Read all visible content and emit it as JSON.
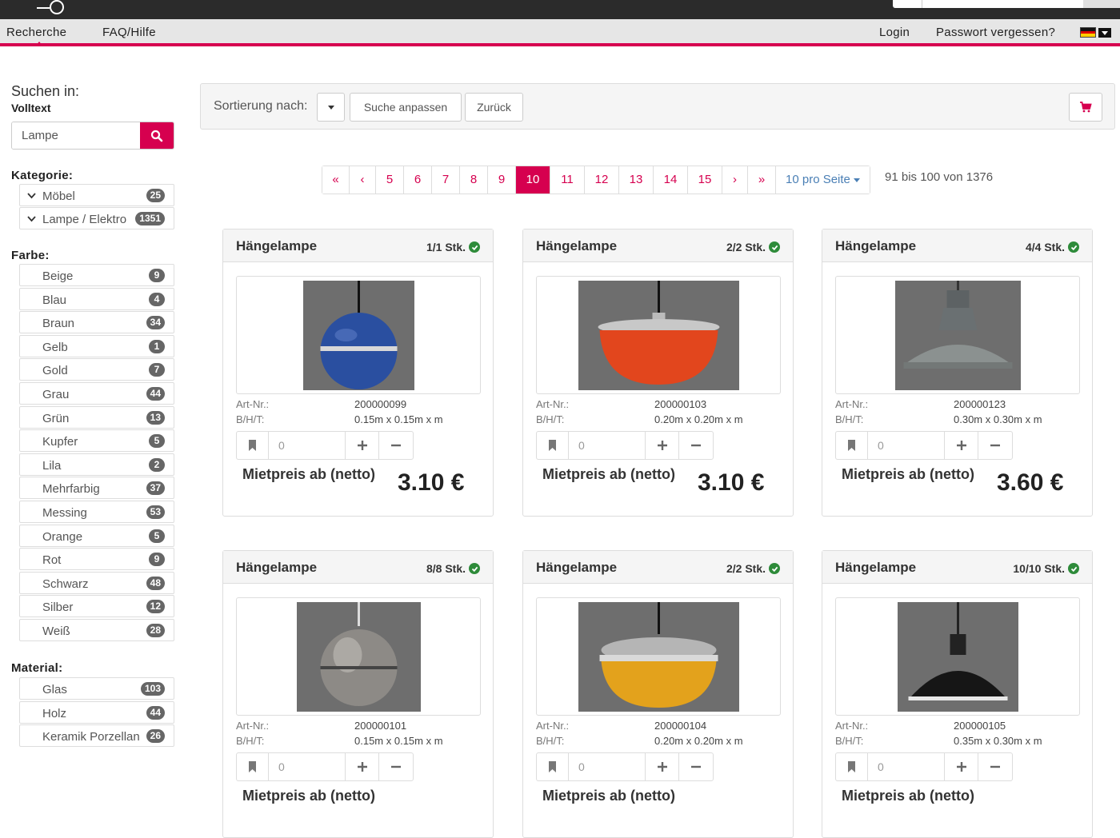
{
  "nav": {
    "items": [
      "Recherche",
      "FAQ/Hilfe"
    ],
    "login": "Login",
    "forgot": "Passwort vergessen?"
  },
  "sidebar": {
    "title": "Suchen in:",
    "subtitle": "Volltext",
    "search_value": "Lampe",
    "category_head": "Kategorie:",
    "categories": [
      {
        "label": "Möbel",
        "count": "25"
      },
      {
        "label": "Lampe / Elektro",
        "count": "1351"
      }
    ],
    "color_head": "Farbe:",
    "colors": [
      {
        "label": "Beige",
        "count": "9"
      },
      {
        "label": "Blau",
        "count": "4"
      },
      {
        "label": "Braun",
        "count": "34"
      },
      {
        "label": "Gelb",
        "count": "1"
      },
      {
        "label": "Gold",
        "count": "7"
      },
      {
        "label": "Grau",
        "count": "44"
      },
      {
        "label": "Grün",
        "count": "13"
      },
      {
        "label": "Kupfer",
        "count": "5"
      },
      {
        "label": "Lila",
        "count": "2"
      },
      {
        "label": "Mehrfarbig",
        "count": "37"
      },
      {
        "label": "Messing",
        "count": "53"
      },
      {
        "label": "Orange",
        "count": "5"
      },
      {
        "label": "Rot",
        "count": "9"
      },
      {
        "label": "Schwarz",
        "count": "48"
      },
      {
        "label": "Silber",
        "count": "12"
      },
      {
        "label": "Weiß",
        "count": "28"
      }
    ],
    "material_head": "Material:",
    "materials": [
      {
        "label": "Glas",
        "count": "103"
      },
      {
        "label": "Holz",
        "count": "44"
      },
      {
        "label": "Keramik Porzellan",
        "count": "26"
      }
    ]
  },
  "toolbar": {
    "sort_label": "Sortierung nach:",
    "adjust": "Suche anpassen",
    "back": "Zurück"
  },
  "pagination": {
    "first": "«",
    "prev": "‹",
    "pages": [
      "5",
      "6",
      "7",
      "8",
      "9",
      "10",
      "11",
      "12",
      "13",
      "14",
      "15"
    ],
    "active": "10",
    "next": "›",
    "last": "»",
    "per_page": "10 pro Seite",
    "count": "91 bis 100 von 1376"
  },
  "labels": {
    "art_nr": "Art-Nr.:",
    "dims": "B/H/T:",
    "price_label": "Mietpreis ab (netto)",
    "qty": "0"
  },
  "products": [
    {
      "title": "Hängelampe",
      "stock": "1/1 Stk.",
      "art_nr": "200000099",
      "dims": "0.15m x 0.15m x m",
      "price": "3.10 €",
      "lamp": "blue"
    },
    {
      "title": "Hängelampe",
      "stock": "2/2 Stk.",
      "art_nr": "200000103",
      "dims": "0.20m x 0.20m x m",
      "price": "3.10 €",
      "lamp": "orange"
    },
    {
      "title": "Hängelampe",
      "stock": "4/4 Stk.",
      "art_nr": "200000123",
      "dims": "0.30m x 0.30m x m",
      "price": "3.60 €",
      "lamp": "grey"
    },
    {
      "title": "Hängelampe",
      "stock": "8/8 Stk.",
      "art_nr": "200000101",
      "dims": "0.15m x 0.15m x m",
      "price": "",
      "lamp": "silver"
    },
    {
      "title": "Hängelampe",
      "stock": "2/2 Stk.",
      "art_nr": "200000104",
      "dims": "0.20m x 0.20m x m",
      "price": "",
      "lamp": "yellow"
    },
    {
      "title": "Hängelampe",
      "stock": "10/10 Stk.",
      "art_nr": "200000105",
      "dims": "0.35m x 0.30m x m",
      "price": "",
      "lamp": "black"
    }
  ],
  "colors": {
    "accent": "#d6004f",
    "badge": "#666666",
    "ok": "#2e8b3a"
  }
}
